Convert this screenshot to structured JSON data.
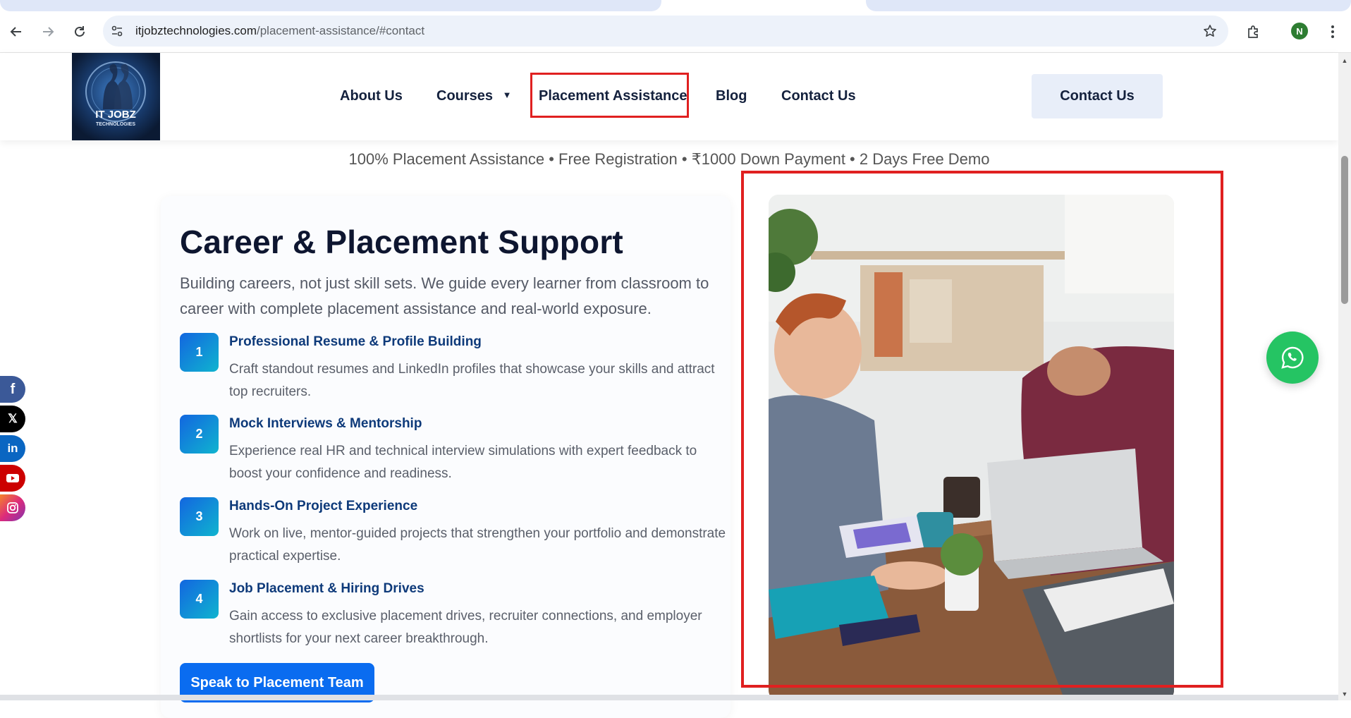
{
  "browser": {
    "url_domain": "itjobztechnologies.com",
    "url_path": "/placement-assistance/#contact",
    "profile_initial": "N"
  },
  "header": {
    "logo_text": "IT JOBZ",
    "logo_subtext": "TECHNOLOGIES",
    "nav": {
      "about": "About Us",
      "courses": "Courses",
      "courses_caret": "▼",
      "placement": "Placement Assistance",
      "blog": "Blog",
      "contact": "Contact Us"
    },
    "contact_button": "Contact Us"
  },
  "tagline": "100% Placement Assistance • Free Registration • ₹1000 Down Payment • 2 Days Free Demo",
  "section": {
    "title": "Career & Placement Support",
    "description": "Building careers, not just skill sets. We guide every learner from classroom to career with complete placement assistance and real-world exposure.",
    "steps": [
      {
        "num": "1",
        "title": "Professional Resume & Profile Building",
        "text": "Craft standout resumes and LinkedIn profiles that showcase your skills and attract top recruiters."
      },
      {
        "num": "2",
        "title": "Mock Interviews & Mentorship",
        "text": "Experience real HR and technical interview simulations with expert feedback to boost your confidence and readiness."
      },
      {
        "num": "3",
        "title": "Hands-On Project Experience",
        "text": "Work on live, mentor-guided projects that strengthen your portfolio and demonstrate practical expertise."
      },
      {
        "num": "4",
        "title": "Job Placement & Hiring Drives",
        "text": "Gain access to exclusive placement drives, recruiter connections, and employer shortlists for your next career breakthrough."
      }
    ],
    "cta": "Speak to Placement Team"
  },
  "social": {
    "facebook": "f",
    "x": "𝕏",
    "linkedin": "in"
  },
  "colors": {
    "accent_blue": "#0a6cf0",
    "highlight_red": "#e02020",
    "whatsapp_green": "#25c463",
    "nav_text": "#14213d"
  }
}
